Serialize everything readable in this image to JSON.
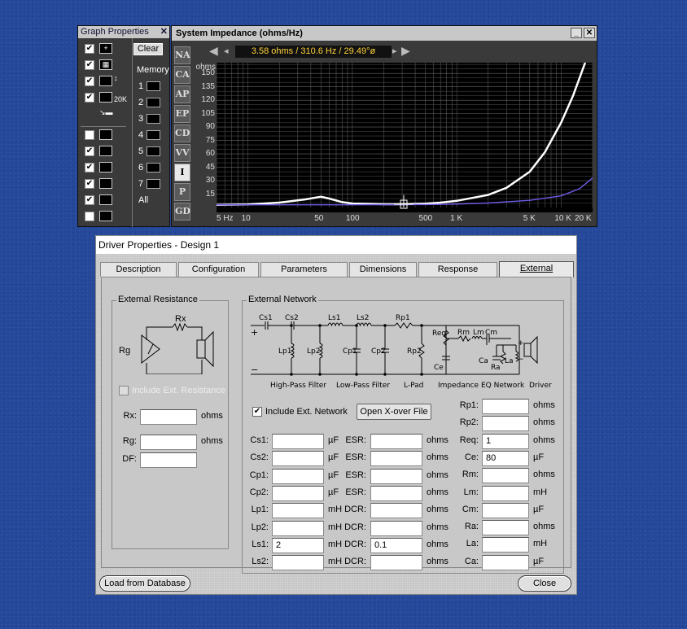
{
  "graph_props": {
    "title": "Graph Properties",
    "close": "✕",
    "clear_label": "Clear",
    "memory_label": "Memory",
    "memory_slots": [
      "1",
      "2",
      "3",
      "4",
      "5",
      "6",
      "7"
    ],
    "all_label": "All",
    "icon_20k": "20K",
    "checks": [
      true,
      true,
      true,
      true,
      false,
      true,
      true,
      true,
      true,
      false,
      false
    ]
  },
  "impedance": {
    "title": "System Impedance (ohms/Hz)",
    "readout": "3.58 ohms / 310.6 Hz / 29.49°ø",
    "minimize": "_",
    "close": "✕",
    "tabs": [
      "NA",
      "CA",
      "AP",
      "EP",
      "CD",
      "VV",
      "I",
      "P",
      "GD"
    ],
    "active_tab": "I"
  },
  "chart_data": {
    "type": "line",
    "ylabel": "ohms",
    "yticks": [
      "150",
      "135",
      "120",
      "105",
      "90",
      "75",
      "60",
      "45",
      "30",
      "15"
    ],
    "ylim": [
      0,
      162
    ],
    "xticks": [
      "5 Hz",
      "10",
      "50",
      "100",
      "500",
      "1 K",
      "5 K",
      "10 K",
      "20 K"
    ],
    "xtick_values": [
      5,
      10,
      50,
      100,
      500,
      1000,
      5000,
      10000,
      20000
    ],
    "xlim": [
      5,
      20000
    ],
    "xscale": "log",
    "grid": true,
    "cursor_hz": 310.6,
    "series": [
      {
        "color": "#ffffff",
        "x": [
          5,
          10,
          20,
          35,
          50,
          60,
          80,
          100,
          150,
          200,
          310,
          500,
          700,
          1000,
          2000,
          3000,
          5000,
          7000,
          10000,
          13000,
          17000
        ],
        "y": [
          3,
          3.5,
          5.5,
          9,
          12,
          10,
          6,
          4.5,
          4,
          3.6,
          3.6,
          4.3,
          5.5,
          7.5,
          14,
          22,
          40,
          62,
          95,
          125,
          162
        ]
      },
      {
        "color": "#6c5ce7",
        "x": [
          5,
          50,
          100,
          500,
          1000,
          2000,
          5000,
          10000,
          15000,
          20000
        ],
        "y": [
          3,
          3,
          3,
          3.3,
          3.8,
          5,
          8,
          13,
          21,
          33
        ]
      }
    ]
  },
  "driver": {
    "title": "Driver Properties - Design 1",
    "tabs": [
      "Description",
      "Configuration",
      "Parameters",
      "Dimensions",
      "Response",
      "External"
    ],
    "active_tab": "External",
    "ext_res": {
      "group": "External Resistance",
      "include": "Include Ext. Resistance",
      "fields": [
        {
          "label": "Rx:",
          "value": "",
          "unit": "ohms"
        },
        {
          "label": "Rg:",
          "value": "",
          "unit": "ohms"
        },
        {
          "label": "DF:",
          "value": "",
          "unit": ""
        }
      ],
      "schem": {
        "rx": "Rx",
        "rg": "Rg"
      }
    },
    "ext_net": {
      "group": "External Network",
      "include": "Include Ext. Network",
      "include_checked": true,
      "open_xover": "Open X-over File",
      "schem": {
        "cs1": "Cs1",
        "cs2": "Cs2",
        "ls1": "Ls1",
        "ls2": "Ls2",
        "rp1": "Rp1",
        "lp1": "Lp1",
        "lp2": "Lp2",
        "cp1": "Cp1",
        "cp2": "Cp2",
        "rp2": "Rp2",
        "req": "Req",
        "rm": "Rm",
        "lm": "Lm",
        "cm": "Cm",
        "ce": "Ce",
        "ca": "Ca",
        "ra": "Ra",
        "la": "La",
        "plus": "+",
        "minus": "−",
        "hp": "High-Pass Filter",
        "lp": "Low-Pass Filter",
        "lpad": "L-Pad",
        "imp": "Impedance EQ Network",
        "drv": "Driver"
      },
      "left_fields": [
        {
          "label": "Cs1:",
          "value": "",
          "unit": "µF",
          "l2": "ESR:",
          "v2": "",
          "u2": "ohms"
        },
        {
          "label": "Cs2:",
          "value": "",
          "unit": "µF",
          "l2": "ESR:",
          "v2": "",
          "u2": "ohms"
        },
        {
          "label": "Cp1:",
          "value": "",
          "unit": "µF",
          "l2": "ESR:",
          "v2": "",
          "u2": "ohms"
        },
        {
          "label": "Cp2:",
          "value": "",
          "unit": "µF",
          "l2": "ESR:",
          "v2": "",
          "u2": "ohms"
        },
        {
          "label": "Lp1:",
          "value": "",
          "unit": "mH",
          "l2": "DCR:",
          "v2": "",
          "u2": "ohms"
        },
        {
          "label": "Lp2:",
          "value": "",
          "unit": "mH",
          "l2": "DCR:",
          "v2": "",
          "u2": "ohms"
        },
        {
          "label": "Ls1:",
          "value": "2",
          "unit": "mH",
          "l2": "DCR:",
          "v2": "0.1",
          "u2": "ohms"
        },
        {
          "label": "Ls2:",
          "value": "",
          "unit": "mH",
          "l2": "DCR:",
          "v2": "",
          "u2": "ohms"
        }
      ],
      "right_fields": [
        {
          "label": "Rp1:",
          "value": "",
          "unit": "ohms"
        },
        {
          "label": "Rp2:",
          "value": "",
          "unit": "ohms"
        },
        {
          "label": "Req:",
          "value": "1",
          "unit": "ohms"
        },
        {
          "label": "Ce:",
          "value": "80",
          "unit": "µF"
        },
        {
          "label": "Rm:",
          "value": "",
          "unit": "ohms"
        },
        {
          "label": "Lm:",
          "value": "",
          "unit": "mH"
        },
        {
          "label": "Cm:",
          "value": "",
          "unit": "µF"
        },
        {
          "label": "Ra:",
          "value": "",
          "unit": "ohms"
        },
        {
          "label": "La:",
          "value": "",
          "unit": "mH"
        },
        {
          "label": "Ca:",
          "value": "",
          "unit": "µF"
        }
      ]
    },
    "load_db": "Load from Database",
    "close": "Close"
  }
}
